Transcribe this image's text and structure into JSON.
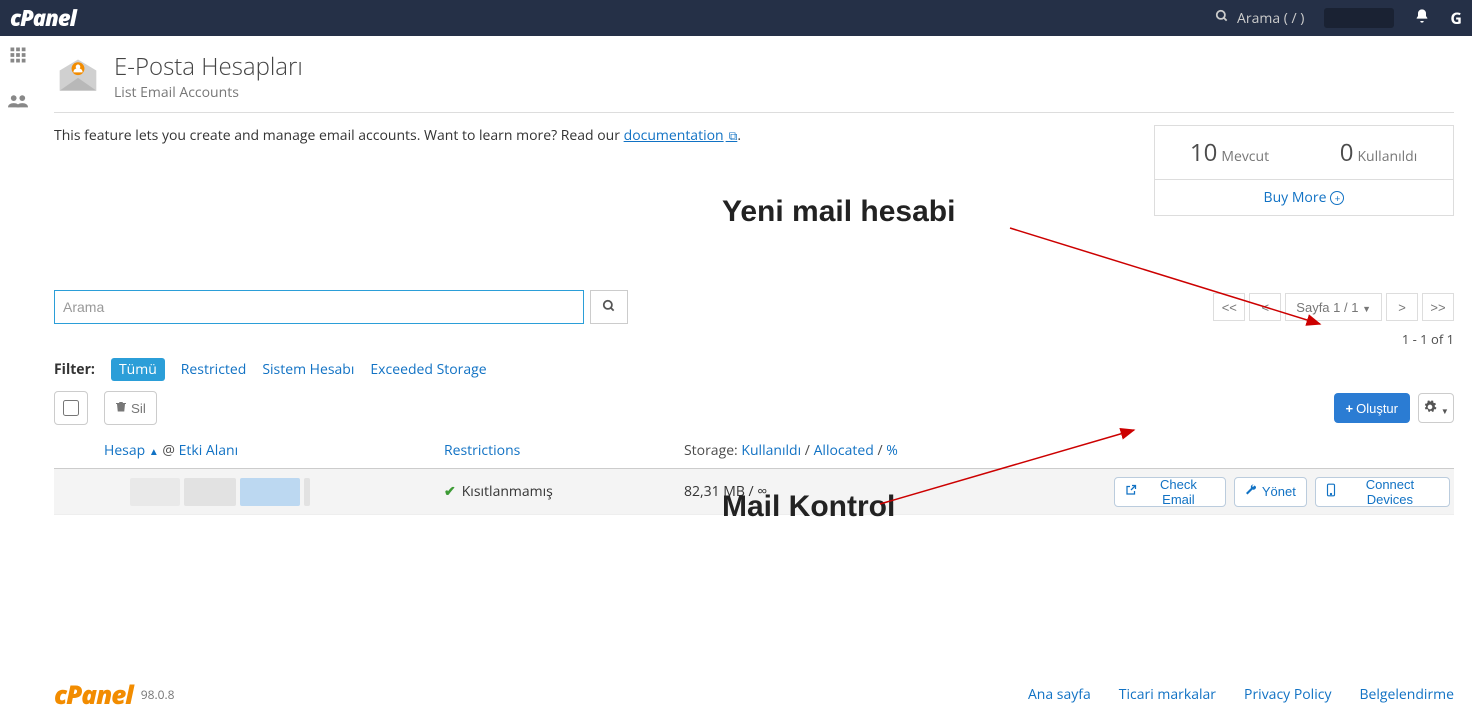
{
  "topbar": {
    "search_label": "Arama ( / )"
  },
  "header": {
    "title": "E-Posta Hesapları",
    "subtitle": "List Email Accounts"
  },
  "intro": {
    "text_lead": "This feature lets you create and manage email accounts. Want to learn more? Read our ",
    "doc_link": "documentation",
    "text_tail": "."
  },
  "stats": {
    "available_num": "10",
    "available_lbl": "Mevcut",
    "used_num": "0",
    "used_lbl": "Kullanıldı",
    "buy_more": "Buy More"
  },
  "annotations": {
    "a1": "Yeni mail hesabi",
    "a2": "Mail Kontrol"
  },
  "search": {
    "placeholder": "Arama"
  },
  "pager": {
    "first": "<<",
    "prev": "<",
    "label": "Sayfa 1 / 1",
    "next": ">",
    "last": ">>",
    "count_label": "1 - 1 of 1"
  },
  "filter": {
    "label": "Filter:",
    "all": "Tümü",
    "restricted": "Restricted",
    "system": "Sistem Hesabı",
    "exceeded": "Exceeded Storage"
  },
  "toolbar": {
    "delete": "Sil",
    "create": "Oluştur"
  },
  "thead": {
    "account": "Hesap",
    "at": "@",
    "domain": "Etki Alanı",
    "restrictions": "Restrictions",
    "storage_lbl": "Storage: ",
    "used": "Kullanıldı",
    "allocated": "Allocated",
    "pct": "%"
  },
  "row": {
    "restriction": "Kısıtlanmamış",
    "storage": "82,31 MB / ∞",
    "check_email": "Check Email",
    "manage": "Yönet",
    "connect_devices": "Connect Devices"
  },
  "footer": {
    "version": "98.0.8",
    "home": "Ana sayfa",
    "trademarks": "Ticari markalar",
    "privacy": "Privacy Policy",
    "doc": "Belgelendirme"
  }
}
